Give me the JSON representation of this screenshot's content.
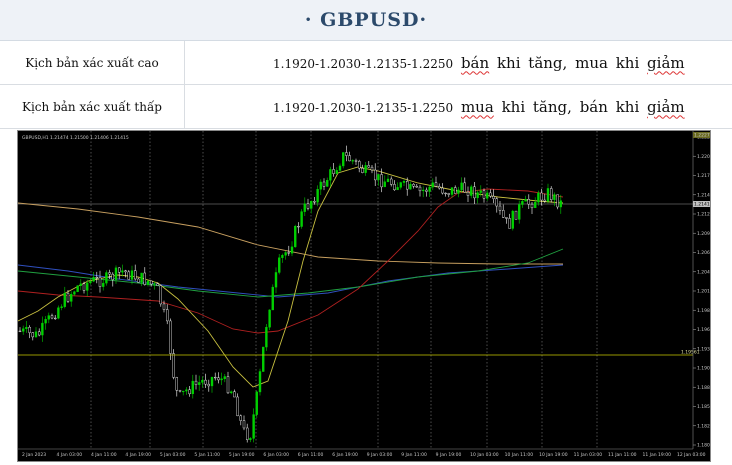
{
  "header": {
    "title": "· GBPUSD·"
  },
  "scenarios": [
    {
      "label": "Kịch bản xác xuất cao",
      "levels": "1.1920-1.2030-1.2135-1.2250",
      "action": "bán khi tăng, mua khi giảm"
    },
    {
      "label": "Kịch bản xác xuất thấp",
      "levels": "1.1920-1.2030-1.2135-1.2250",
      "action": "mua khi tăng, bán khi giảm"
    }
  ],
  "chart": {
    "symbol_info": "GBPUSD,H1  1.21474 1.21500 1.21406 1.21415",
    "y_ticks": [
      "1.22270",
      "1.22015",
      "1.21740",
      "1.21465",
      "1.21220",
      "1.20965",
      "1.20690",
      "1.20420",
      "1.20155",
      "1.19890",
      "1.19630",
      "1.19345",
      "1.19060",
      "1.18800",
      "1.18535",
      "1.18280",
      "1.18010"
    ],
    "x_ticks": [
      "2 Jan 2023",
      "4 Jan 03:00",
      "4 Jan 11:00",
      "4 Jan 19:00",
      "5 Jan 03:00",
      "5 Jan 11:00",
      "5 Jan 19:00",
      "6 Jan 03:00",
      "6 Jan 11:00",
      "6 Jan 19:00",
      "9 Jan 03:00",
      "9 Jan 11:00",
      "9 Jan 19:00",
      "10 Jan 03:00",
      "10 Jan 11:00",
      "10 Jan 19:00",
      "11 Jan 03:00",
      "11 Jan 11:00",
      "11 Jan 19:00",
      "12 Jan 03:00"
    ],
    "price_tag": "1.21415",
    "top_tag": "1.22270",
    "hline_tag": "1.19561",
    "colors": {
      "bull": "#00d000",
      "bear": "#ffffff",
      "ma_yellow": "#c8c040",
      "ma_red": "#b02020",
      "ma_tan": "#c8a060",
      "ma_blue": "#3050c0",
      "ma_green": "#20a040",
      "hline": "#c8c800"
    }
  }
}
